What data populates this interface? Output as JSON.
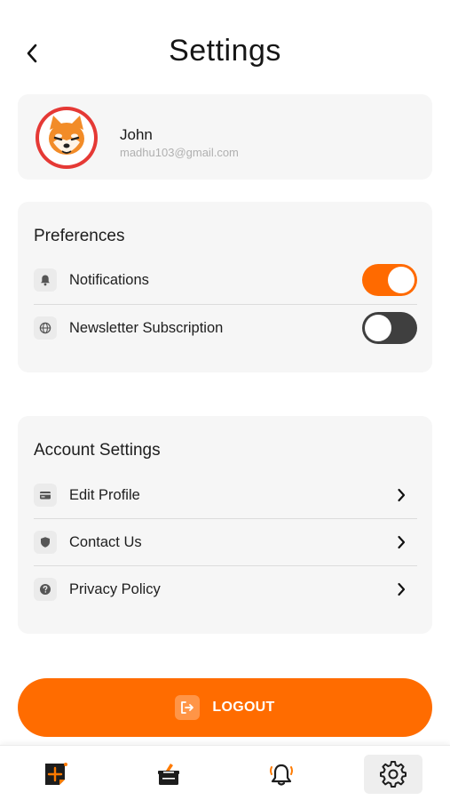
{
  "header": {
    "title": "Settings",
    "back_icon": "chevron-left-icon"
  },
  "profile": {
    "name": "John",
    "email": "madhu103@gmail.com",
    "avatar_icon": "shiba-avatar-icon"
  },
  "preferences": {
    "title": "Preferences",
    "items": [
      {
        "label": "Notifications",
        "icon": "bell-icon",
        "enabled": true
      },
      {
        "label": "Newsletter Subscription",
        "icon": "globe-icon",
        "enabled": false
      }
    ]
  },
  "account": {
    "title": "Account Settings",
    "items": [
      {
        "label": "Edit Profile",
        "icon": "card-icon"
      },
      {
        "label": "Contact Us",
        "icon": "shield-icon"
      },
      {
        "label": "Privacy Policy",
        "icon": "help-icon"
      }
    ]
  },
  "logout": {
    "label": "LOGOUT",
    "icon": "logout-icon"
  },
  "bottom_nav": {
    "items": [
      {
        "name": "add",
        "icon": "add-post-icon",
        "active": false
      },
      {
        "name": "vote",
        "icon": "ballot-box-icon",
        "active": false
      },
      {
        "name": "alerts",
        "icon": "bell-ringing-icon",
        "active": false
      },
      {
        "name": "settings",
        "icon": "gear-icon",
        "active": true
      }
    ]
  },
  "colors": {
    "accent": "#ff6c00",
    "toggle_off": "#3f3f3f",
    "card_bg": "#f6f6f6"
  }
}
